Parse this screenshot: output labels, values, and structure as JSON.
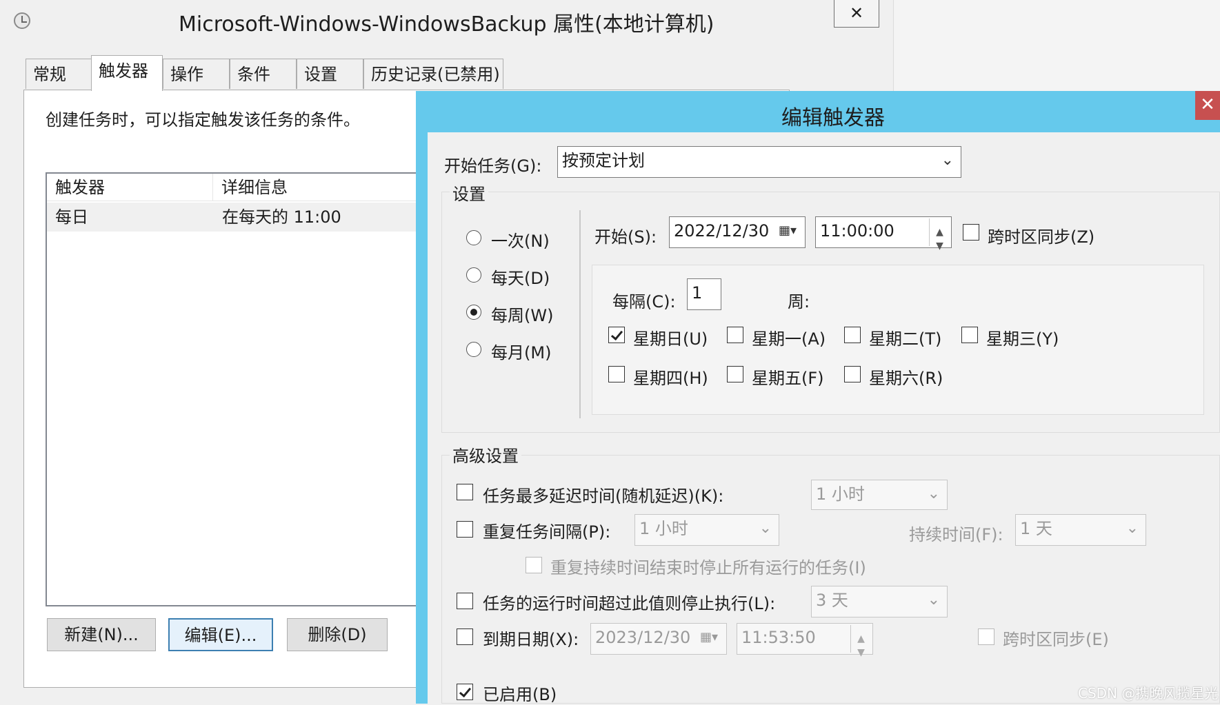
{
  "main_window": {
    "title": "Microsoft-Windows-WindowsBackup 属性(本地计算机)",
    "close_label": "✕",
    "tabs": [
      "常规",
      "触发器",
      "操作",
      "条件",
      "设置",
      "历史记录(已禁用)"
    ],
    "description": "创建任务时，可以指定触发该任务的条件。",
    "trigger_list": {
      "columns": [
        "触发器",
        "详细信息"
      ],
      "rows": [
        {
          "trigger": "每日",
          "detail": "在每天的 11:00"
        }
      ]
    },
    "buttons": {
      "new": "新建(N)...",
      "edit": "编辑(E)...",
      "delete": "删除(D)"
    }
  },
  "edit_trigger": {
    "title": "编辑触发器",
    "close_label": "✕",
    "begin_task_label": "开始任务(G):",
    "begin_task_value": "按预定计划",
    "settings_label": "设置",
    "schedule_options": [
      {
        "label": "一次(N)",
        "selected": false
      },
      {
        "label": "每天(D)",
        "selected": false
      },
      {
        "label": "每周(W)",
        "selected": true
      },
      {
        "label": "每月(M)",
        "selected": false
      }
    ],
    "start_label": "开始(S):",
    "start_date": "2022/12/30",
    "start_time": "11:00:00",
    "sync_tz_label": "跨时区同步(Z)",
    "recur_label": "每隔(C):",
    "recur_value": "1",
    "recur_unit": "周:",
    "weekdays": [
      {
        "label": "星期日(U)",
        "checked": true
      },
      {
        "label": "星期一(A)",
        "checked": false
      },
      {
        "label": "星期二(T)",
        "checked": false
      },
      {
        "label": "星期三(Y)",
        "checked": false
      },
      {
        "label": "星期四(H)",
        "checked": false
      },
      {
        "label": "星期五(F)",
        "checked": false
      },
      {
        "label": "星期六(R)",
        "checked": false
      }
    ],
    "advanced_label": "高级设置",
    "delay_label": "任务最多延迟时间(随机延迟)(K):",
    "delay_value": "1 小时",
    "repeat_label": "重复任务间隔(P):",
    "repeat_value": "1 小时",
    "duration_label": "持续时间(F):",
    "duration_value": "1 天",
    "stop_all_label": "重复持续时间结束时停止所有运行的任务(I)",
    "stop_longer_label": "任务的运行时间超过此值则停止执行(L):",
    "stop_longer_value": "3 天",
    "expire_label": "到期日期(X):",
    "expire_date": "2023/12/30",
    "expire_time": "11:53:50",
    "expire_sync_label": "跨时区同步(E)",
    "enabled_label": "已启用(B)"
  },
  "watermark": "CSDN @携晚风揽星光"
}
